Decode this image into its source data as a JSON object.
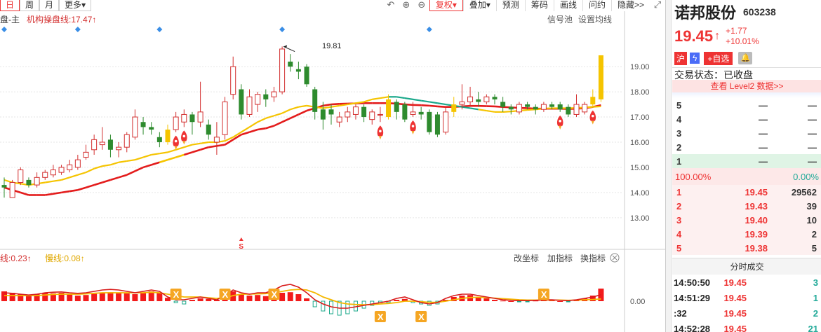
{
  "toolbar": {
    "tabs": [
      {
        "label": "日",
        "active": true
      },
      {
        "label": "周",
        "active": false
      },
      {
        "label": "月",
        "active": false
      },
      {
        "label": "更多",
        "active": false
      }
    ],
    "buttons": [
      "复权",
      "叠加",
      "预测",
      "筹码",
      "画线",
      "问约",
      "隐藏>>"
    ],
    "icons": [
      "undo-icon",
      "zoom-in-icon",
      "zoom-out-icon",
      "fullscreen-icon"
    ]
  },
  "chart": {
    "legend_main": "盘-主",
    "legend_inst": "机构操盘线:17.47↑",
    "right_links": [
      "信号池",
      "设置均线"
    ],
    "high_label": "19.81",
    "sub_legend_fast": "线:0.23↑",
    "sub_legend_slow": "慢线:0.08↑",
    "sub_links": [
      "改坐标",
      "加指标",
      "换指标"
    ],
    "sub_zero_label": "0.00",
    "s_marker": "S",
    "x_marker": "X",
    "colors": {
      "up": "#d32f2f",
      "down": "#2e8b2e",
      "yellow": "#f5c400",
      "red": "#e31b1b",
      "teal": "#1aa88a"
    }
  },
  "chart_data": {
    "type": "line",
    "title": "",
    "xlabel": "",
    "ylabel": "",
    "y_ticks": [
      "19.00",
      "18.00",
      "17.00",
      "16.00",
      "15.00",
      "14.00",
      "13.00"
    ],
    "ylim": [
      12.3,
      20.2
    ],
    "candles": [
      [
        14.3,
        14.2,
        14.6,
        13.8
      ],
      [
        13.8,
        14.4,
        14.5,
        13.8
      ],
      [
        14.4,
        14.9,
        15.0,
        14.3
      ],
      [
        14.5,
        14.3,
        14.6,
        14.2
      ],
      [
        14.3,
        14.6,
        14.8,
        14.2
      ],
      [
        14.6,
        14.8,
        14.9,
        14.5
      ],
      [
        14.7,
        14.9,
        15.1,
        14.6
      ],
      [
        14.8,
        15.0,
        15.1,
        14.7
      ],
      [
        14.9,
        15.1,
        15.3,
        14.8
      ],
      [
        15.0,
        15.3,
        15.5,
        14.9
      ],
      [
        15.4,
        15.6,
        15.9,
        15.3
      ],
      [
        15.7,
        16.1,
        16.3,
        15.5
      ],
      [
        15.9,
        16.0,
        16.6,
        15.7
      ],
      [
        16.1,
        15.7,
        16.3,
        15.4
      ],
      [
        15.7,
        15.8,
        16.0,
        15.4
      ],
      [
        15.8,
        16.3,
        16.4,
        15.6
      ],
      [
        16.2,
        17.0,
        17.3,
        16.1
      ],
      [
        16.8,
        16.6,
        17.0,
        16.3
      ],
      [
        16.6,
        16.5,
        16.8,
        16.3
      ],
      [
        16.2,
        16.0,
        16.4,
        15.8
      ],
      [
        16.0,
        16.5,
        16.7,
        15.9
      ],
      [
        16.5,
        17.0,
        17.2,
        16.4
      ],
      [
        16.8,
        17.1,
        17.3,
        16.6
      ],
      [
        17.1,
        16.8,
        17.2,
        16.3
      ],
      [
        16.8,
        17.2,
        18.4,
        16.6
      ],
      [
        16.7,
        16.3,
        16.9,
        16.1
      ],
      [
        16.0,
        16.2,
        16.8,
        15.5
      ],
      [
        16.3,
        17.6,
        17.8,
        16.1
      ],
      [
        17.9,
        19.0,
        19.4,
        17.7
      ],
      [
        18.1,
        17.1,
        18.3,
        16.9
      ],
      [
        17.1,
        17.8,
        18.1,
        17.0
      ],
      [
        17.5,
        17.9,
        18.0,
        17.2
      ],
      [
        17.9,
        17.7,
        18.1,
        17.4
      ],
      [
        17.8,
        18.0,
        18.2,
        17.6
      ],
      [
        18.0,
        19.7,
        19.8,
        17.9
      ],
      [
        19.2,
        19.0,
        19.5,
        18.8
      ],
      [
        18.9,
        18.8,
        19.2,
        18.5
      ],
      [
        19.0,
        18.3,
        19.1,
        18.2
      ],
      [
        18.1,
        17.2,
        18.2,
        16.9
      ],
      [
        17.3,
        16.9,
        17.6,
        16.5
      ],
      [
        17.3,
        17.1,
        17.5,
        16.7
      ],
      [
        16.8,
        17.0,
        17.2,
        16.6
      ],
      [
        17.0,
        17.2,
        17.4,
        16.8
      ],
      [
        17.1,
        17.4,
        17.5,
        16.9
      ],
      [
        17.4,
        17.0,
        17.5,
        16.8
      ],
      [
        16.9,
        17.2,
        17.3,
        16.7
      ],
      [
        17.1,
        17.1,
        17.4,
        16.8
      ],
      [
        17.0,
        17.7,
        17.9,
        16.9
      ],
      [
        17.6,
        17.2,
        17.7,
        16.9
      ],
      [
        17.5,
        16.9,
        17.6,
        16.8
      ],
      [
        17.1,
        17.2,
        17.6,
        17.0
      ],
      [
        17.2,
        17.1,
        17.4,
        16.9
      ],
      [
        17.2,
        16.4,
        17.3,
        16.3
      ],
      [
        17.1,
        16.3,
        17.2,
        16.2
      ],
      [
        16.4,
        17.2,
        17.4,
        16.3
      ],
      [
        17.2,
        17.5,
        17.8,
        17.0
      ],
      [
        17.5,
        17.6,
        18.3,
        17.3
      ],
      [
        17.6,
        17.8,
        18.2,
        17.4
      ],
      [
        17.7,
        17.6,
        18.0,
        17.4
      ],
      [
        17.6,
        17.8,
        17.9,
        17.5
      ],
      [
        17.8,
        17.7,
        17.9,
        17.5
      ],
      [
        17.6,
        17.4,
        17.8,
        17.2
      ],
      [
        17.4,
        17.3,
        17.5,
        17.1
      ],
      [
        17.2,
        17.5,
        17.6,
        17.1
      ],
      [
        17.5,
        17.4,
        17.6,
        17.3
      ],
      [
        17.4,
        17.3,
        17.5,
        17.1
      ],
      [
        17.3,
        17.5,
        17.6,
        17.2
      ],
      [
        17.5,
        17.4,
        17.6,
        17.3
      ],
      [
        17.5,
        17.3,
        17.6,
        17.2
      ],
      [
        17.4,
        17.1,
        17.5,
        17.0
      ],
      [
        17.1,
        17.5,
        17.9,
        17.0
      ],
      [
        17.2,
        17.5,
        17.6,
        17.1
      ],
      [
        17.5,
        17.8,
        18.1,
        17.4
      ],
      [
        17.7,
        19.45,
        19.45,
        17.6
      ]
    ],
    "special_yellow": [
      20,
      47,
      55,
      72,
      73
    ],
    "inst_line": [
      14.2,
      14.1,
      14.0,
      13.9,
      13.9,
      13.9,
      13.95,
      14.0,
      14.05,
      14.1,
      14.2,
      14.3,
      14.4,
      14.5,
      14.6,
      14.7,
      14.85,
      15.0,
      15.1,
      15.2,
      15.3,
      15.4,
      15.5,
      15.6,
      15.7,
      15.8,
      15.85,
      15.9,
      16.1,
      16.3,
      16.4,
      16.5,
      16.55,
      16.65,
      16.8,
      16.95,
      17.1,
      17.25,
      17.35,
      17.45,
      17.5,
      17.52,
      17.53,
      17.54,
      17.55,
      17.55,
      17.55,
      17.55,
      17.53,
      17.5,
      17.48,
      17.47,
      17.45,
      17.42,
      17.4,
      17.4,
      17.42,
      17.44,
      17.44,
      17.43,
      17.42,
      17.4,
      17.38,
      17.36,
      17.35,
      17.33,
      17.33,
      17.33,
      17.33,
      17.32,
      17.33,
      17.35,
      17.4,
      17.47
    ],
    "yellow_line": [
      14.5,
      14.4,
      14.35,
      14.3,
      14.35,
      14.4,
      14.45,
      14.5,
      14.6,
      14.7,
      14.8,
      14.95,
      15.05,
      15.1,
      15.2,
      15.25,
      15.3,
      15.4,
      15.5,
      15.55,
      15.6,
      15.7,
      15.8,
      15.9,
      15.95,
      16.0,
      16.0,
      16.05,
      16.2,
      16.4,
      16.6,
      16.8,
      16.95,
      17.05,
      17.15,
      17.3,
      17.4,
      17.45,
      17.4,
      17.35,
      17.4,
      17.45,
      17.5,
      17.55,
      17.6,
      17.7,
      17.75,
      17.8,
      17.8,
      17.75,
      17.7,
      17.65,
      17.6,
      17.55,
      17.5,
      17.45,
      17.4,
      17.35,
      17.3,
      17.25,
      17.2,
      17.2,
      17.22,
      17.25,
      17.28,
      17.3,
      17.33,
      17.35,
      17.35,
      17.35,
      17.36,
      17.38,
      17.4,
      17.42
    ],
    "macd_hist": [
      0.35,
      0.3,
      0.25,
      0.2,
      0.25,
      0.3,
      0.28,
      0.3,
      0.25,
      0.2,
      0.22,
      0.26,
      0.3,
      0.32,
      0.3,
      0.28,
      0.25,
      0.3,
      0.35,
      0.3,
      0.12,
      -0.05,
      -0.1,
      0.05,
      0.1,
      0.08,
      0.05,
      0.2,
      0.35,
      0.25,
      0.2,
      0.22,
      0.18,
      0.25,
      0.3,
      0.32,
      0.25,
      0.1,
      -0.2,
      -0.35,
      -0.45,
      -0.5,
      -0.45,
      -0.35,
      -0.25,
      -0.15,
      -0.1,
      -0.05,
      0.05,
      0.08,
      -0.05,
      -0.1,
      -0.15,
      -0.1,
      0.05,
      0.15,
      0.2,
      0.22,
      0.15,
      0.1,
      0.05,
      0.02,
      0.0,
      -0.02,
      -0.01,
      0.02,
      0.05,
      0.03,
      0.0,
      -0.02,
      0.05,
      0.1,
      0.2,
      0.45
    ],
    "macd_fast": [
      0.3,
      0.28,
      0.25,
      0.22,
      0.25,
      0.3,
      0.32,
      0.33,
      0.3,
      0.28,
      0.3,
      0.35,
      0.4,
      0.42,
      0.4,
      0.35,
      0.3,
      0.35,
      0.4,
      0.35,
      0.15,
      0.05,
      0.05,
      0.1,
      0.15,
      0.1,
      0.05,
      0.2,
      0.4,
      0.3,
      0.25,
      0.3,
      0.3,
      0.4,
      0.55,
      0.6,
      0.5,
      0.3,
      0.05,
      -0.1,
      -0.2,
      -0.25,
      -0.25,
      -0.2,
      -0.15,
      -0.1,
      -0.05,
      0.0,
      0.1,
      0.15,
      0.05,
      -0.05,
      -0.1,
      -0.05,
      0.1,
      0.2,
      0.25,
      0.25,
      0.2,
      0.15,
      0.1,
      0.05,
      0.03,
      0.02,
      0.02,
      0.03,
      0.05,
      0.05,
      0.03,
      0.02,
      0.05,
      0.1,
      0.15,
      0.23
    ],
    "macd_slow": [
      0.2,
      0.2,
      0.2,
      0.2,
      0.2,
      0.22,
      0.24,
      0.25,
      0.25,
      0.25,
      0.26,
      0.28,
      0.3,
      0.3,
      0.3,
      0.3,
      0.3,
      0.3,
      0.32,
      0.3,
      0.25,
      0.2,
      0.15,
      0.15,
      0.15,
      0.12,
      0.1,
      0.12,
      0.2,
      0.25,
      0.25,
      0.26,
      0.27,
      0.3,
      0.35,
      0.4,
      0.42,
      0.4,
      0.3,
      0.15,
      0.05,
      -0.05,
      -0.1,
      -0.12,
      -0.13,
      -0.12,
      -0.1,
      -0.08,
      -0.05,
      0.0,
      0.0,
      -0.02,
      -0.04,
      -0.04,
      0.0,
      0.05,
      0.1,
      0.13,
      0.14,
      0.13,
      0.11,
      0.09,
      0.07,
      0.05,
      0.04,
      0.04,
      0.04,
      0.04,
      0.04,
      0.03,
      0.04,
      0.05,
      0.06,
      0.08
    ],
    "diamond_markers": [
      0,
      9,
      19,
      34,
      52
    ],
    "rocket_markers": [
      21,
      22,
      46,
      50,
      68,
      72
    ],
    "x_markers": [
      21,
      27,
      33,
      46,
      51,
      66
    ]
  },
  "panel": {
    "name": "诺邦股份",
    "code": "603238",
    "price": "19.45",
    "change": "+1.77",
    "change_pct": "+10.01%",
    "tag_hu": "沪",
    "tag_add": "+自选",
    "status": "交易状态：已收盘",
    "level2": "查看 Level2 数据>>",
    "sell": [
      {
        "level": "5",
        "price": "—",
        "vol": "—"
      },
      {
        "level": "4",
        "price": "—",
        "vol": "—"
      },
      {
        "level": "3",
        "price": "—",
        "vol": "—"
      },
      {
        "level": "2",
        "price": "—",
        "vol": "—"
      },
      {
        "level": "1",
        "price": "—",
        "vol": "—"
      }
    ],
    "pct_left": "100.00%",
    "pct_right": "0.00%",
    "buy": [
      {
        "level": "1",
        "price": "19.45",
        "vol": "29562"
      },
      {
        "level": "2",
        "price": "19.43",
        "vol": "39"
      },
      {
        "level": "3",
        "price": "19.40",
        "vol": "10"
      },
      {
        "level": "4",
        "price": "19.39",
        "vol": "2"
      },
      {
        "level": "5",
        "price": "19.38",
        "vol": "5"
      }
    ],
    "ticks_title": "分时成交",
    "ticks": [
      {
        "time": "14:50:50",
        "price": "19.45",
        "vol": "3"
      },
      {
        "time": "14:51:29",
        "price": "19.45",
        "vol": "1"
      },
      {
        "time": ":32",
        "price": "19.45",
        "vol": "2"
      },
      {
        "time": "14:52:28",
        "price": "19.45",
        "vol": "21"
      }
    ]
  }
}
